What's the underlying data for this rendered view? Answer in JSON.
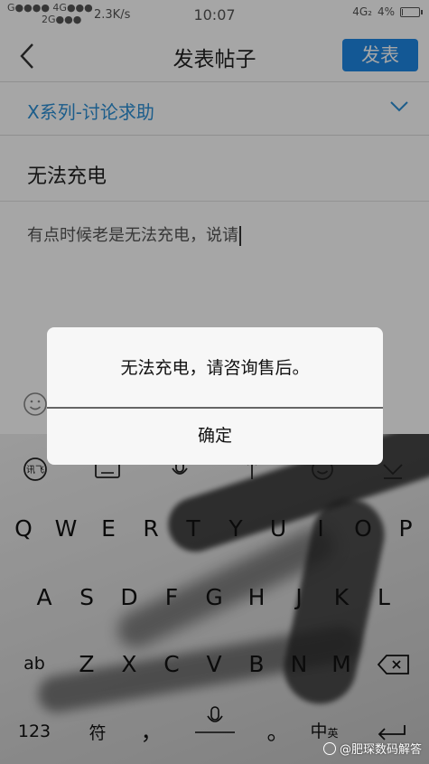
{
  "status_bar": {
    "carrier_1": "G●●●●",
    "network_1": "4G●●●",
    "network_2": "2G●●●",
    "speed": "2.3K/s",
    "time": "10:07",
    "network_right": "4G₂",
    "battery": "4%"
  },
  "header": {
    "title": "发表帖子",
    "publish_label": "发表"
  },
  "form": {
    "category": "X系列-讨论求助",
    "post_title": "无法充电",
    "post_body": "有点时候老是无法充电，说请"
  },
  "keyboard": {
    "row1": [
      "Q",
      "W",
      "E",
      "R",
      "T",
      "Y",
      "U",
      "I",
      "O",
      "P"
    ],
    "row2": [
      "A",
      "S",
      "D",
      "F",
      "G",
      "H",
      "J",
      "K",
      "L"
    ],
    "row3": [
      "Z",
      "X",
      "C",
      "V",
      "B",
      "N",
      "M"
    ],
    "shift_label": "ab",
    "num_label": "123",
    "symbol_label": "符",
    "comma_label": "，",
    "period_label": "。",
    "lang_label": "中",
    "lang_sub": "英",
    "voice_tool_label": "讯飞"
  },
  "dialog": {
    "message": "无法充电，请咨询售后。",
    "confirm_label": "确定"
  },
  "watermark": "@肥琛数码解答",
  "colors": {
    "accent": "#2b8fd6",
    "publish_button": "#1e88e5"
  }
}
